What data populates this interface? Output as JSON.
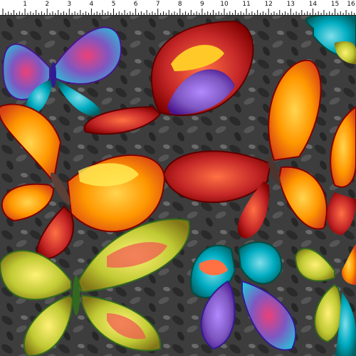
{
  "ruler": {
    "numbers": [
      "1",
      "2",
      "3",
      "4",
      "5",
      "6",
      "7",
      "8",
      "9",
      "10",
      "11",
      "12",
      "13",
      "14",
      "15",
      "16"
    ]
  },
  "fabric": {
    "background_color": "#3b3b3b",
    "motif": "butterflies",
    "palette": [
      "#d81b1b",
      "#f57c00",
      "#ffb300",
      "#9ccc65",
      "#26c6da",
      "#7e57c2",
      "#ec407a",
      "#ffee58"
    ]
  }
}
